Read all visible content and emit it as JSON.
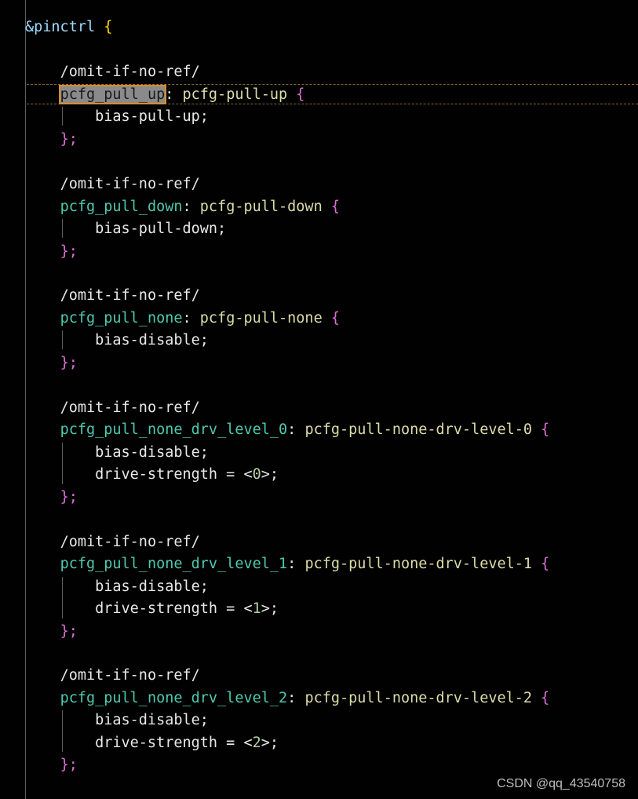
{
  "editor": {
    "root_ref": "&pinctrl",
    "open_brace": "{",
    "close_brace": "};",
    "blocks": [
      {
        "directive": "/omit-if-no-ref/",
        "label": "pcfg_pull_up",
        "colon": ":",
        "node_name": "pcfg-pull-up",
        "open_brace": "{",
        "props": [
          "bias-pull-up;"
        ],
        "close": "};"
      },
      {
        "directive": "/omit-if-no-ref/",
        "label": "pcfg_pull_down",
        "colon": ":",
        "node_name": "pcfg-pull-down",
        "open_brace": "{",
        "props": [
          "bias-pull-down;"
        ],
        "close": "};"
      },
      {
        "directive": "/omit-if-no-ref/",
        "label": "pcfg_pull_none",
        "colon": ":",
        "node_name": "pcfg-pull-none",
        "open_brace": "{",
        "props": [
          "bias-disable;"
        ],
        "close": "};"
      },
      {
        "directive": "/omit-if-no-ref/",
        "label": "pcfg_pull_none_drv_level_0",
        "colon": ":",
        "node_name": "pcfg-pull-none-drv-level-0",
        "open_brace": "{",
        "props": [
          "bias-disable;"
        ],
        "drive_prefix": "drive-strength = <",
        "drive_value": "0",
        "drive_suffix": ">;",
        "close": "};"
      },
      {
        "directive": "/omit-if-no-ref/",
        "label": "pcfg_pull_none_drv_level_1",
        "colon": ":",
        "node_name": "pcfg-pull-none-drv-level-1",
        "open_brace": "{",
        "props": [
          "bias-disable;"
        ],
        "drive_prefix": "drive-strength = <",
        "drive_value": "1",
        "drive_suffix": ">;",
        "close": "};"
      },
      {
        "directive": "/omit-if-no-ref/",
        "label": "pcfg_pull_none_drv_level_2",
        "colon": ":",
        "node_name": "pcfg-pull-none-drv-level-2",
        "open_brace": "{",
        "props": [
          "bias-disable;"
        ],
        "drive_prefix": "drive-strength = <",
        "drive_value": "2",
        "drive_suffix": ">;",
        "close": "};"
      }
    ]
  },
  "watermark": "CSDN @qq_43540758",
  "colors": {
    "background": "#010101",
    "label": "#4ec9b0",
    "node_name": "#dcdcaa",
    "brace_yellow": "#ffd700",
    "brace_purple": "#da70d6",
    "number": "#b5cea8",
    "selection_outline": "#d98c2c"
  }
}
